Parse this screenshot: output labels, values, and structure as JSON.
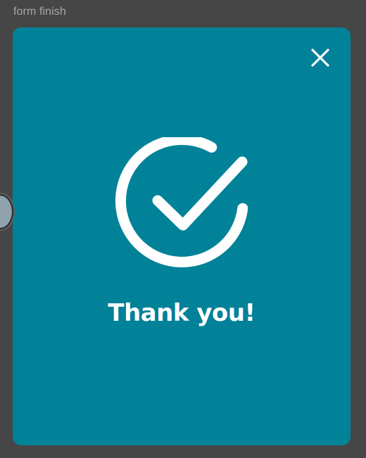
{
  "frame": {
    "label": "form finish"
  },
  "modal": {
    "background_color": "#028299",
    "close_icon": "close-icon",
    "success_icon": "check-circle-icon",
    "title": "Thank you!"
  },
  "canvas": {
    "background_color": "#464646",
    "connector_handle_color": "#8fa2ad"
  }
}
